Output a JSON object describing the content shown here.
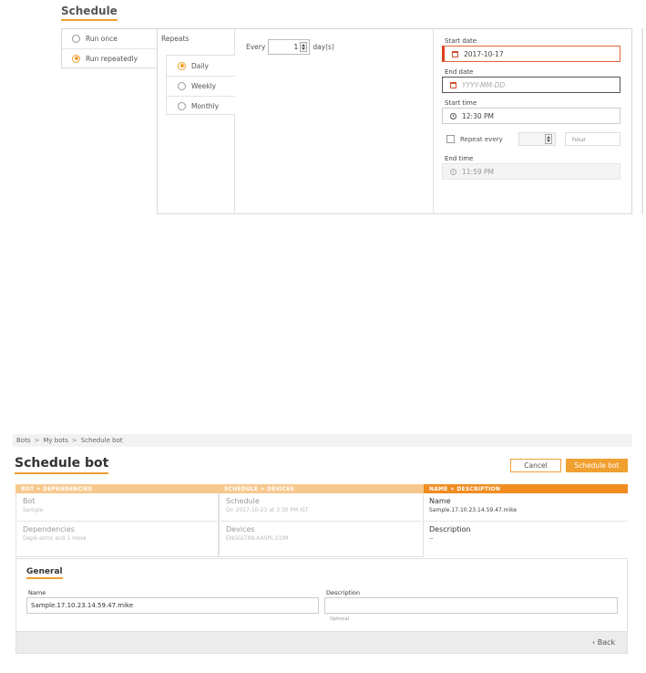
{
  "schedule_panel": {
    "title": "Schedule",
    "run_options": [
      {
        "label": "Run once",
        "selected": false
      },
      {
        "label": "Run repeatedly",
        "selected": true
      }
    ],
    "repeats_label": "Repeats",
    "frequency_options": [
      {
        "label": "Daily",
        "selected": true
      },
      {
        "label": "Weekly",
        "selected": false
      },
      {
        "label": "Monthly",
        "selected": false
      }
    ],
    "every": {
      "prefix": "Every",
      "value": "1",
      "suffix": "day(s)"
    },
    "start_date": {
      "label": "Start date",
      "value": "2017-10-17",
      "icon": "calendar-icon"
    },
    "end_date": {
      "label": "End date",
      "placeholder": "YYYY-MM-DD",
      "icon": "calendar-icon"
    },
    "start_time": {
      "label": "Start time",
      "value": "12:30 PM",
      "icon": "clock-icon"
    },
    "repeat_every": {
      "label": "Repeat every",
      "checked": false,
      "value": "",
      "unit": "hour"
    },
    "end_time": {
      "label": "End time",
      "value": "11:59 PM",
      "disabled": true,
      "icon": "clock-icon"
    }
  },
  "schedule_bot": {
    "breadcrumb": [
      "Bots",
      "My bots",
      "Schedule bot"
    ],
    "breadcrumb_separator": ">",
    "title": "Schedule bot",
    "buttons": {
      "cancel": "Cancel",
      "primary": "Schedule bot"
    },
    "steps": [
      {
        "header": "BOT + DEPENDENCIES",
        "active": false,
        "items": [
          {
            "title": "Bot",
            "subtitle": "Sample"
          },
          {
            "title": "Dependencies",
            "subtitle": "Dep6 atmx and 1 more"
          }
        ]
      },
      {
        "header": "SCHEDULE + DEVICES",
        "active": false,
        "items": [
          {
            "title": "Schedule",
            "subtitle": "On 2017-10-23 at 3:30 PM IST"
          },
          {
            "title": "Devices",
            "subtitle": "ENGGLT88.AASPL.COM"
          }
        ]
      },
      {
        "header": "NAME + DESCRIPTION",
        "active": true,
        "items": [
          {
            "title": "Name",
            "subtitle": "Sample.17.10.23.14.59.47.mike"
          },
          {
            "title": "Description",
            "subtitle": "--"
          }
        ]
      }
    ],
    "general": {
      "title": "General",
      "name_label": "Name",
      "name_value": "Sample.17.10.23.14.59.47.mike",
      "description_label": "Description",
      "description_value": "",
      "description_hint": "Optional"
    },
    "back_label": "‹ Back",
    "colors": {
      "accent": "#f0a030",
      "step_active": "#f08c20",
      "step_inactive": "#f7c88e",
      "error": "#e04020"
    }
  }
}
